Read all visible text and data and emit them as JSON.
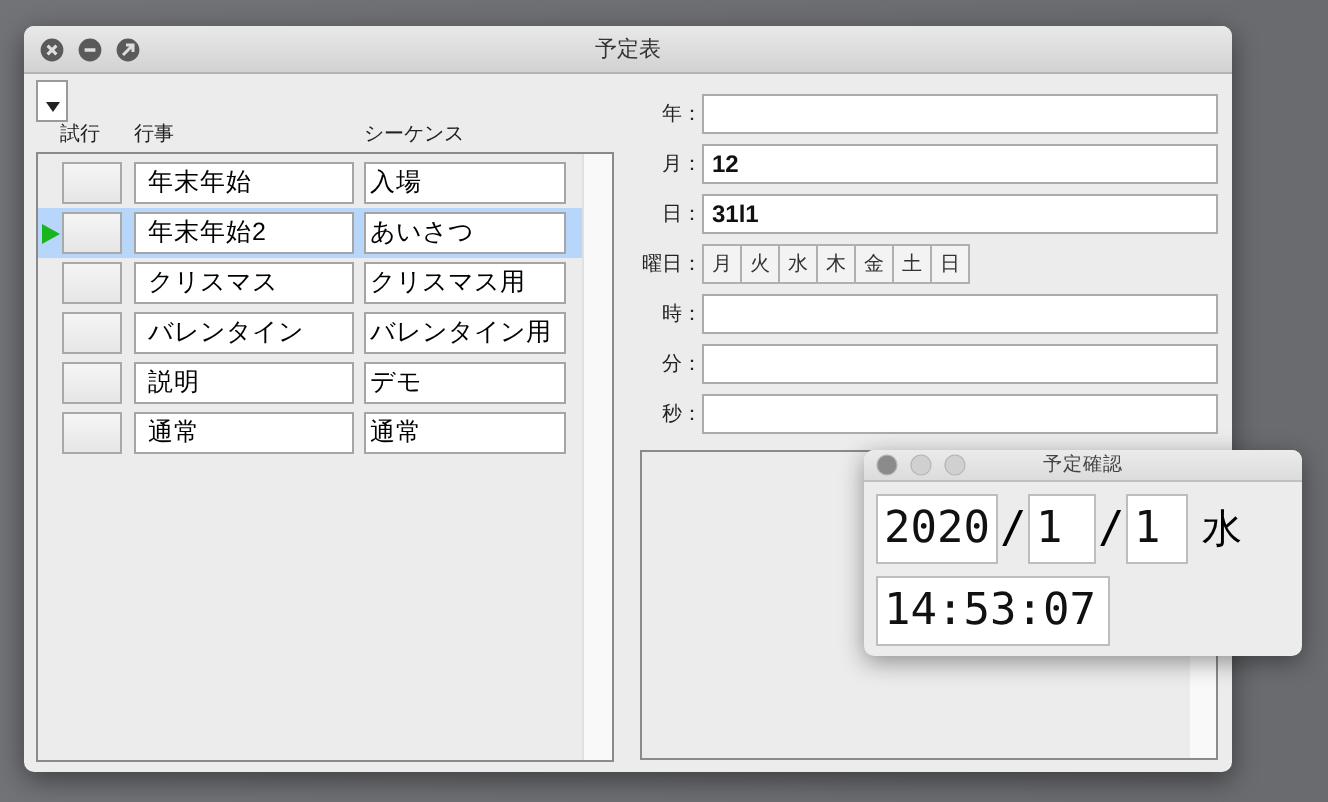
{
  "window": {
    "title": "予定表"
  },
  "list": {
    "columns": [
      "試行",
      "行事",
      "シーケンス"
    ],
    "rows": [
      {
        "event": "年末年始",
        "sequence": "入場",
        "selected": false
      },
      {
        "event": "年末年始2",
        "sequence": "あいさつ",
        "selected": true
      },
      {
        "event": "クリスマス",
        "sequence": "クリスマス用",
        "selected": false
      },
      {
        "event": "バレンタイン",
        "sequence": "バレンタイン用",
        "selected": false
      },
      {
        "event": "説明",
        "sequence": "デモ",
        "selected": false
      },
      {
        "event": "通常",
        "sequence": "通常",
        "selected": false
      }
    ]
  },
  "form": {
    "fields": [
      {
        "kind": "text",
        "label": "年："
      },
      {
        "kind": "text",
        "label": "月：",
        "value": "12"
      },
      {
        "kind": "text",
        "label": "日：",
        "value": "31l1"
      },
      {
        "kind": "weekdays",
        "label": "曜日：",
        "days": [
          "月",
          "火",
          "水",
          "木",
          "金",
          "土",
          "日"
        ]
      },
      {
        "kind": "text",
        "label": "時："
      },
      {
        "kind": "text",
        "label": "分："
      },
      {
        "kind": "text",
        "label": "秒："
      }
    ]
  },
  "popup": {
    "title": "予定確認",
    "year": "2020",
    "separators": [
      "/",
      "/"
    ],
    "month": "1",
    "day": "1",
    "weekday": "水",
    "time": "14:53:07"
  }
}
